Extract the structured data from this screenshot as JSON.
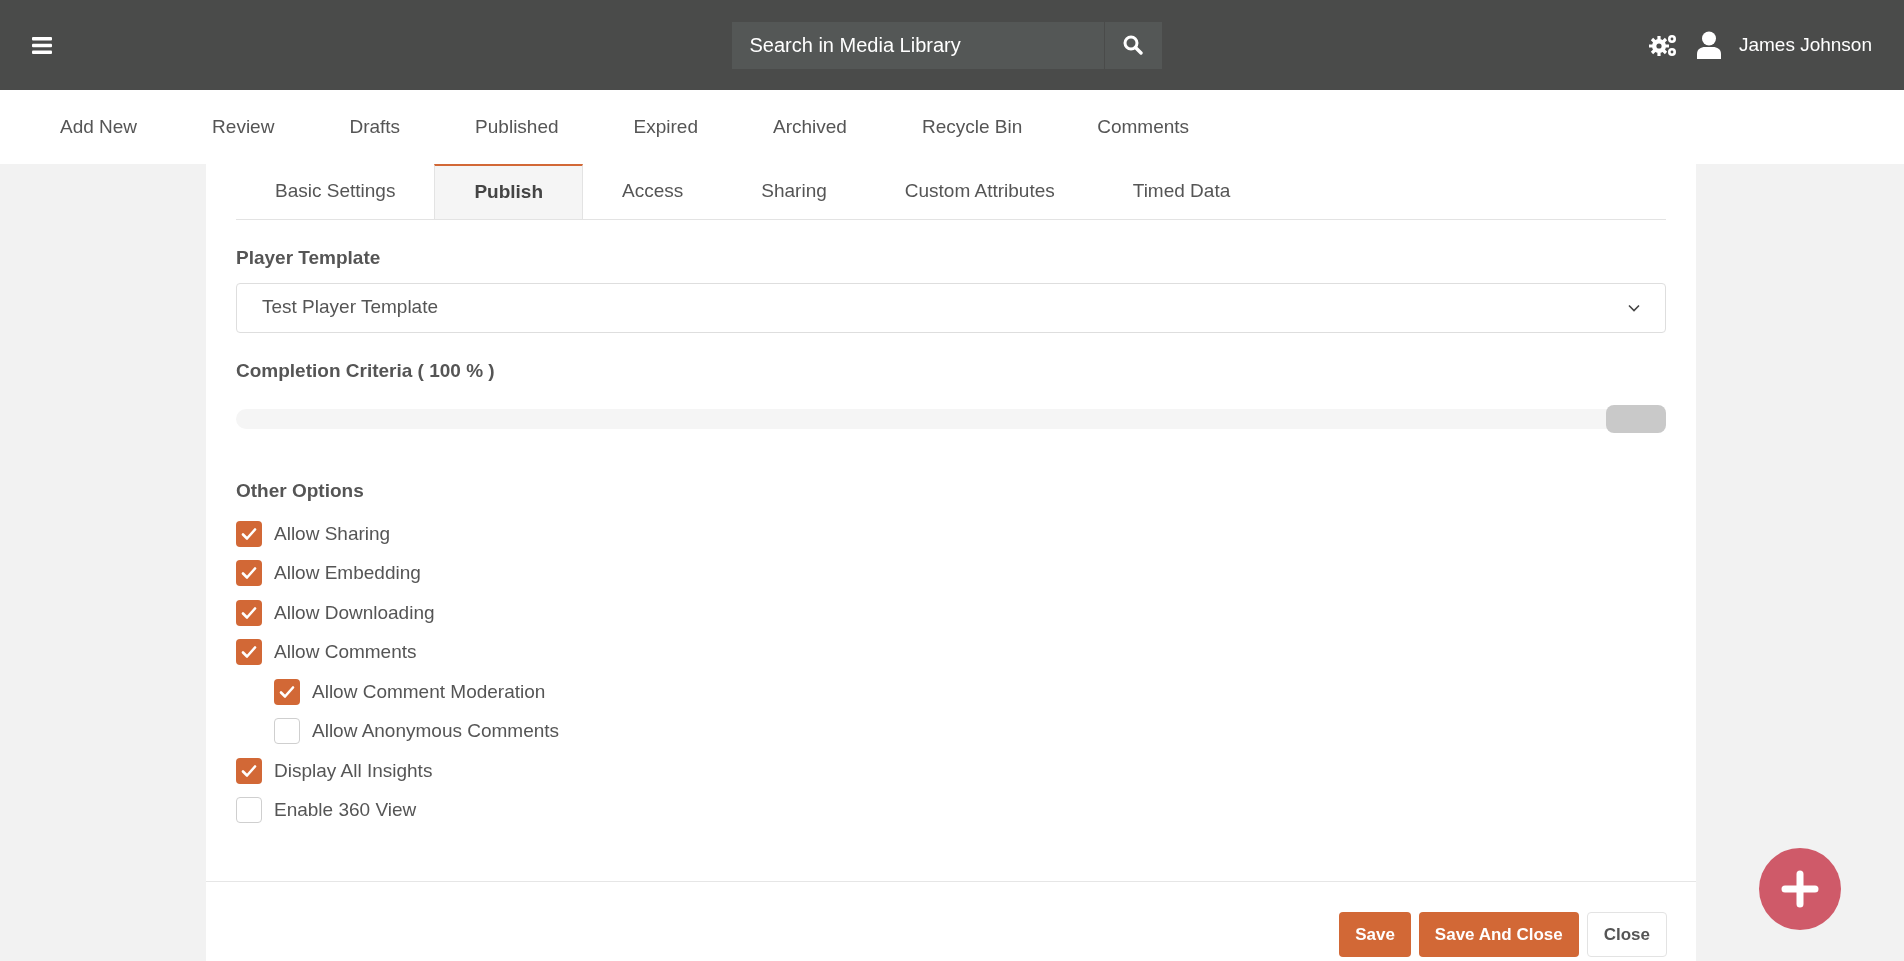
{
  "header": {
    "search": {
      "placeholder": "Search in Media Library"
    },
    "user": {
      "name": "James Johnson"
    }
  },
  "nav": [
    {
      "label": "Add New",
      "selected": false
    },
    {
      "label": "Review",
      "selected": false
    },
    {
      "label": "Drafts",
      "selected": false
    },
    {
      "label": "Published",
      "selected": false
    },
    {
      "label": "Expired",
      "selected": false
    },
    {
      "label": "Archived",
      "selected": false
    },
    {
      "label": "Recycle Bin",
      "selected": false
    },
    {
      "label": "Comments",
      "selected": false
    }
  ],
  "tabs": [
    {
      "label": "Basic Settings",
      "selected": false
    },
    {
      "label": "Publish",
      "selected": true
    },
    {
      "label": "Access",
      "selected": false
    },
    {
      "label": "Sharing",
      "selected": false
    },
    {
      "label": "Custom Attributes",
      "selected": false
    },
    {
      "label": "Timed Data",
      "selected": false
    }
  ],
  "player_template": {
    "label": "Player Template",
    "value": "Test Player Template"
  },
  "completion": {
    "label": "Completion Criteria ( 100 % )",
    "level": 1
  },
  "other_options": {
    "title": "Other Options",
    "options": [
      {
        "label": "Allow Sharing",
        "checked": true
      },
      {
        "label": "Allow Embedding",
        "checked": true
      },
      {
        "label": "Allow Downloading",
        "checked": true
      },
      {
        "label": "Allow Comments",
        "checked": true,
        "children": [
          {
            "label": "Allow Comment Moderation",
            "checked": true
          },
          {
            "label": "Allow Anonymous Comments",
            "checked": false
          }
        ]
      },
      {
        "label": "Display All Insights",
        "checked": true
      },
      {
        "label": "Enable 360 View",
        "checked": false
      }
    ]
  },
  "buttons": [
    {
      "label": "Save",
      "kind": "primary"
    },
    {
      "label": "Save And Close",
      "kind": "primary"
    },
    {
      "label": "Close",
      "kind": "secondary"
    }
  ]
}
